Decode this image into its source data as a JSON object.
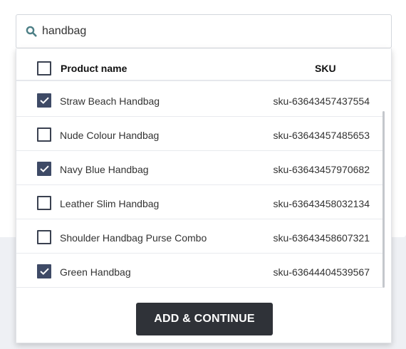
{
  "search": {
    "value": "handbag",
    "placeholder": ""
  },
  "table": {
    "columns": {
      "name": "Product name",
      "sku": "SKU"
    },
    "select_all_checked": false,
    "rows": [
      {
        "name": "Straw Beach Handbag",
        "sku": "sku-63643457437554",
        "checked": true
      },
      {
        "name": "Nude Colour Handbag",
        "sku": "sku-63643457485653",
        "checked": false
      },
      {
        "name": "Navy Blue Handbag",
        "sku": "sku-63643457970682",
        "checked": true
      },
      {
        "name": "Leather Slim Handbag",
        "sku": "sku-63643458032134",
        "checked": false
      },
      {
        "name": "Shoulder Handbag Purse Combo",
        "sku": "sku-63643458607321",
        "checked": false
      },
      {
        "name": "Green Handbag",
        "sku": "sku-63644404539567",
        "checked": true
      }
    ]
  },
  "actions": {
    "add_continue_label": "ADD & CONTINUE"
  },
  "icons": {
    "search": "search-icon",
    "checkmark": "checkmark-icon"
  },
  "colors": {
    "checkbox_checked": "#3e4a66",
    "button_bg": "#2f3238",
    "search_icon": "#4d7f86"
  }
}
